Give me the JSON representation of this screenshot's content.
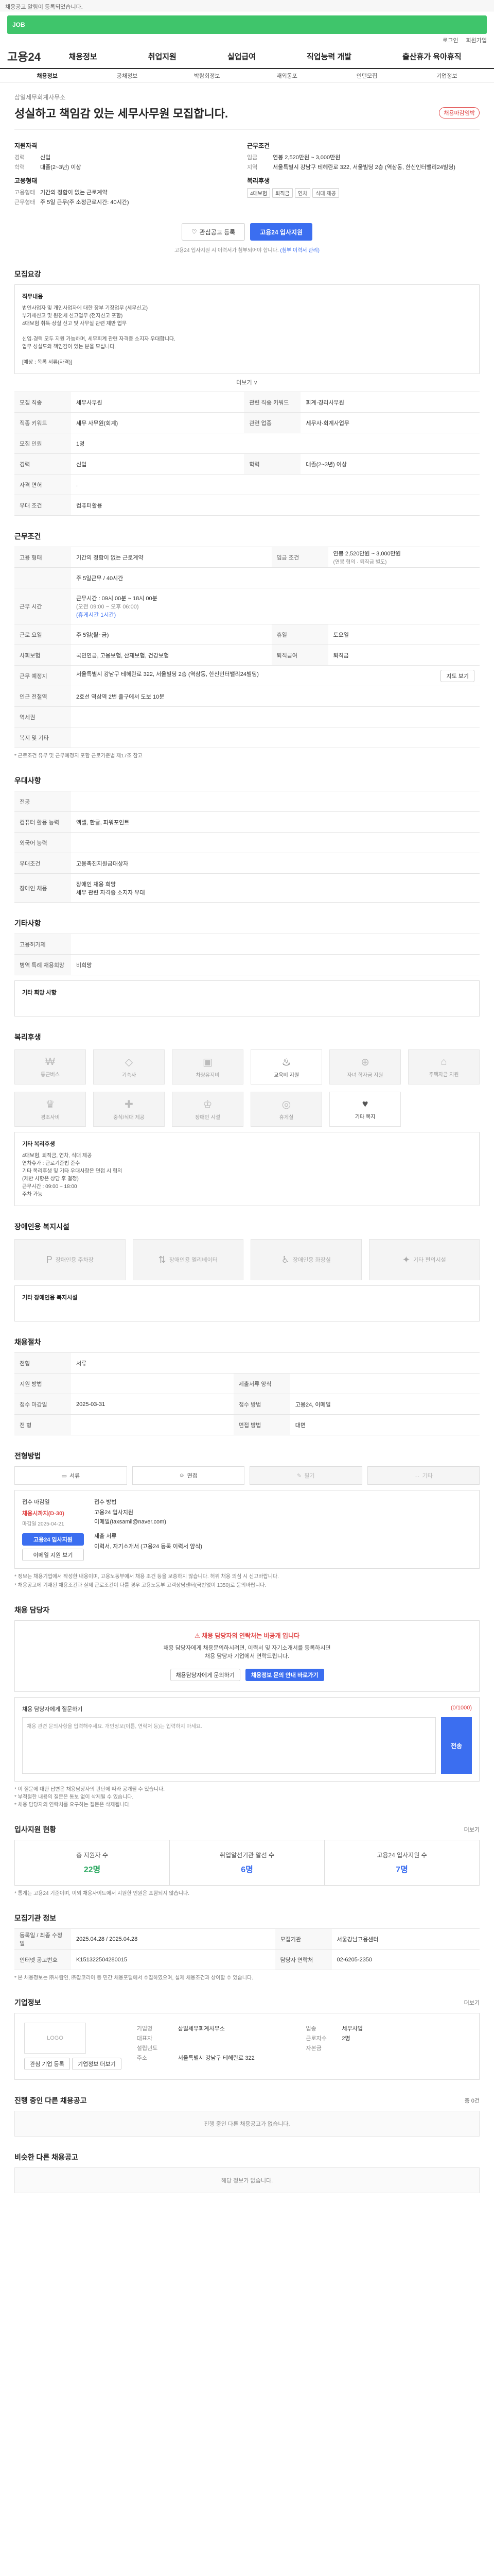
{
  "topnote": "채용공고 알림이 등록되었습니다.",
  "greenbar": "JOB",
  "utility": [
    "로그인",
    "회원가입"
  ],
  "logo": "고용24",
  "gnb": [
    "채용정보",
    "취업지원",
    "실업급여",
    "직업능력 개발",
    "출산휴가 육아휴직"
  ],
  "subnav": [
    "채용정보",
    "공채정보",
    "박람회정보",
    "재외동포",
    "인턴모집",
    "기업정보"
  ],
  "hero": {
    "company": "삼일세무회계사무소",
    "title": "성실하고 책임감 있는 세무사무원 모집합니다.",
    "badge": "채용마감임박"
  },
  "summary": {
    "left": {
      "h1": "지원자격",
      "rows": [
        [
          "경력",
          "신입"
        ],
        [
          "학력",
          "대졸(2~3년) 이상"
        ]
      ],
      "h2": "고용형태",
      "rows2": [
        [
          "고용형태",
          "기간의 정함이 없는 근로계약"
        ],
        [
          "근무형태",
          "주 5일 근무(주 소정근로시간: 40시간)"
        ]
      ]
    },
    "right": {
      "h1": "근무조건",
      "rows": [
        [
          "임금",
          "연봉 2,520만원 ~ 3,000만원"
        ],
        [
          "지역",
          "서울특별시 강남구 테헤란로 322, 서울빌딩 2층 (역삼동, 한신인터밸리24빌딩)"
        ]
      ],
      "h2": "복리후생",
      "chips": [
        "4대보험",
        "퇴직금",
        "연차",
        "식대 제공"
      ]
    }
  },
  "buttons": {
    "scrap": "관심공고 등록",
    "apply": "고용24 입사지원"
  },
  "notice": "고용24 입사지원 시 이력서가 첨부되어야 합니다.",
  "notice_link": "(첨부 이력서 관리)",
  "sec_jobdesc": "모집요강",
  "jobdesc": {
    "title": "직무내용",
    "lines": [
      "법인사업자 및 개인사업자에 대한 장부 기장업무 (세무신고)",
      "부가세신고 및 원천세 신고업무 (전자신고 포함)",
      "4대보험 취득·상실 신고 및 사무실 관련 제반 업무",
      "신입·경력 모두 지원 가능하며, 세무회계 관련 자격증 소지자 우대합니다.",
      "업무 성실도와 책임감이 있는 분을 모십니다.",
      "[예상 : 목록 서류(자격)]"
    ],
    "more": "더보기 ∨"
  },
  "jobinfo": [
    [
      "모집 직종",
      "세무사무원",
      "관련 직종 키워드",
      "회계·경리사무원"
    ],
    [
      "직종 키워드",
      "세무 사무원(회계)",
      "관련 업종",
      "세무사·회계사업무"
    ],
    [
      "모집 인원",
      "1명",
      "",
      ""
    ],
    [
      "경력",
      "신입",
      "학력",
      "대졸(2~3년) 이상"
    ],
    [
      "자격 면허",
      "",
      ".",
      ""
    ],
    [
      "우대 조건",
      "컴퓨터활용",
      "",
      ""
    ]
  ],
  "sec_cond": "근무조건",
  "cond": {
    "type": "기간의 정함이 없는 근로계약",
    "pay_label": "임금 조건",
    "pay": "연봉 2,520만원 ~ 3,000만원",
    "pay_note": "(연봉 협의 · 퇴직금 별도)",
    "meal": "주 5일근무 / 40시간",
    "time_label": "근무 시간",
    "time1": "(오전 09:00 ~ 오후 06:00)",
    "time2": "근무시간 : 09시 00분 ~ 18시 00분",
    "time3": "(휴게시간 1시간)",
    "days_label": "근로 요일",
    "days": "주 5일(월~금)",
    "holiday_label": "휴일",
    "holiday": "토요일",
    "work_label": "사회보험",
    "work": "국민연금, 고용보험, 산재보험, 건강보험",
    "pension_label": "퇴직급여",
    "pension": "퇴직금",
    "addr_label": "근무 예정지",
    "addr": "서울특별시 강남구 테헤란로 322, 서울빌딩 2층 (역삼동, 한신인터밸리24빌딩)",
    "map": "지도 보기",
    "trans_label": "인근 전철역",
    "trans": "2호선 역삼역 2번 출구에서 도보 10분",
    "near_label": "역세권",
    "near": "",
    "etc_label": "복지 및 기타"
  },
  "cond_note": "* 근로조건 유무 및 근무예정지 포함 근로기준법 제17조 참고",
  "sec_apply": "우대사항",
  "apply": [
    [
      "전공",
      ""
    ],
    [
      "컴퓨터 활용 능력",
      "엑셀, 한글, 파워포인트"
    ],
    [
      "외국어 능력",
      ""
    ],
    [
      "우대조건",
      "고용촉진지원금대상자"
    ],
    [
      "장애인 채용",
      "장애인 채용 희망"
    ],
    [
      "기타 우대사항",
      "세무 관련 자격증 소지자 우대"
    ]
  ],
  "sec_etc": "기타사항",
  "etc": [
    [
      "고용허가제",
      ""
    ],
    [
      "병역 특례 채용희망",
      "비희망"
    ]
  ],
  "etc_more": "기타 희망 사항",
  "sec_welfare": "복리후생",
  "welfare": [
    [
      "₩",
      "통근버스",
      false
    ],
    [
      "◇",
      "기숙사",
      false
    ],
    [
      "▣",
      "차량유지비",
      false
    ],
    [
      "♨",
      "교육비 지원",
      true
    ],
    [
      "⊕",
      "자녀 학자금 지원",
      false
    ],
    [
      "⌂",
      "주택자금 지원",
      false
    ],
    [
      "♛",
      "경조사비",
      false
    ],
    [
      "✚",
      "중식/식대 제공",
      false
    ],
    [
      "♔",
      "장애인 시설",
      false
    ],
    [
      "◎",
      "휴게실",
      false
    ],
    [
      "♥",
      "기타 복지",
      true
    ]
  ],
  "welfare_more": "기타 복리후생",
  "welfare_items": [
    "4대보험, 퇴직금, 연차, 식대 제공",
    "연차휴가 : 근로기준법 준수",
    "기타 복리후생 및 기타 우대사항은 면접 시 협의",
    "(제반 사항은 상담 후 결정)",
    "근무시간 : 09:00 ~ 18:00",
    "주차 가능"
  ],
  "sec_disab": "장애인용 복지시설",
  "disab": [
    "장애인용 주차장",
    "장애인용 엘리베이터",
    "장애인용 화장실",
    "기타 편의시설"
  ],
  "disab_more": "기타 장애인용 복지시설",
  "sec_lang": "채용절차",
  "lang": [
    [
      "전형",
      "서류"
    ],
    [
      "지원 방법",
      "",
      "제출서류 양식",
      ""
    ],
    [
      "접수 마감일",
      "2025-03-31",
      "접수 방법",
      "고용24, 이메일"
    ],
    [
      "전 형",
      "",
      "면접 방법",
      "대면"
    ]
  ],
  "sec_method": "전형방법",
  "modes": [
    [
      "서류",
      false
    ],
    [
      "면접",
      false
    ],
    [
      "필기",
      true
    ],
    [
      "기타",
      true
    ]
  ],
  "proc": {
    "l1": "접수 마감일",
    "l2": "채용시까지(D-30)",
    "l3": "마감일 2025-04-21",
    "r1": "접수 방법",
    "r2": "고용24 입사지원",
    "r3": "이메일(taxsamil@naver.com)",
    "r4": "제출 서류",
    "r5": "이력서, 자기소개서 (고용24 등록 이력서 양식)",
    "btn1": "고용24 입사지원",
    "btn2": "이메일 지원 보기"
  },
  "proc_note": "* 정보는 채용기업에서 작성한 내용이며, 고용노동부에서 채용 조건 등을 보증하지 않습니다. 허위 채용 의심 시 신고바랍니다.",
  "proc_note2": "* 채용공고에 기재된 채용조건과 실제 근로조건이 다를 경우 고용노동부 고객상담센터(국번없이 1350)로 문의바랍니다.",
  "sec_contact": "채용 담당자",
  "contact": {
    "h": "채용 담당자의 연락처는 비공개 입니다",
    "p1": "채용 담당자에게 채용문의하시려면, 이력서 및 자기소개서를 등록하시면",
    "p2": "채용 담당자 기업에서 연락드립니다.",
    "b1": "채용담당자에게 문의하기",
    "b2": "채용정보 문의 안내 바로가기"
  },
  "q": {
    "title": "채용 담당자에게 질문하기",
    "right": "(0/1000)",
    "placeholder": "채용 관련 문의사항을 입력해주세요. 개인정보(이름, 연락처 등)는 입력하지 마세요.",
    "send": "전송",
    "n1": "* 이 질문에 대한 답변은 채용담당자의 판단에 따라 공개될 수 있습니다.",
    "n2": "* 부적절한 내용의 질문은 통보 없이 삭제될 수 있습니다.",
    "n3": "* 채용 담당자의 연락처를 요구하는 질문은 삭제됩니다."
  },
  "sec_stat": "입사지원 현황",
  "stat_more": "더보기",
  "stats": [
    [
      "총 지원자 수",
      "22명"
    ],
    [
      "취업알선기관 알선 수",
      "6명"
    ],
    [
      "고용24 입사지원 수",
      "7명"
    ]
  ],
  "stat_note": "* 통계는 고용24 기준이며, 이외 채용사이트에서 지원한 인원은 포함되지 않습니다.",
  "sec_reg": "모집기관 정보",
  "reg": [
    [
      "등록일 / 최종 수정일",
      "2025.04.28 / 2025.04.28",
      "모집기관",
      "서울강남고용센터"
    ],
    [
      "인터넷 공고번호",
      "K151322504280015",
      "담당자 연락처",
      "02-6205-2350"
    ]
  ],
  "reg_note": "* 본 채용정보는 ㈜사람인, ㈜잡코리아 등 민간 채용포털에서 수집하였으며, 실제 채용조건과 상이할 수 있습니다.",
  "sec_company": "기업정보",
  "company_more": "더보기",
  "company": {
    "logo": "LOGO",
    "btn1": "관심 기업 등록",
    "btn2": "기업정보 더보기",
    "rows": [
      [
        "기업명",
        "삼일세무회계사무소",
        "업종",
        "세무사업"
      ],
      [
        "대표자",
        "",
        "근로자수",
        "2명"
      ],
      [
        "설립년도",
        "",
        "자본금",
        ""
      ],
      [
        "주소",
        "서울특별시 강남구 테헤란로 322",
        "",
        ""
      ]
    ]
  },
  "sec_other": "진행 중인 다른 채용공고",
  "other_right": "총 0건",
  "other_empty": "진행 중인 다른 채용공고가 없습니다.",
  "sec_similar": "비슷한 다른 채용공고",
  "similar_empty": "해당 정보가 없습니다."
}
